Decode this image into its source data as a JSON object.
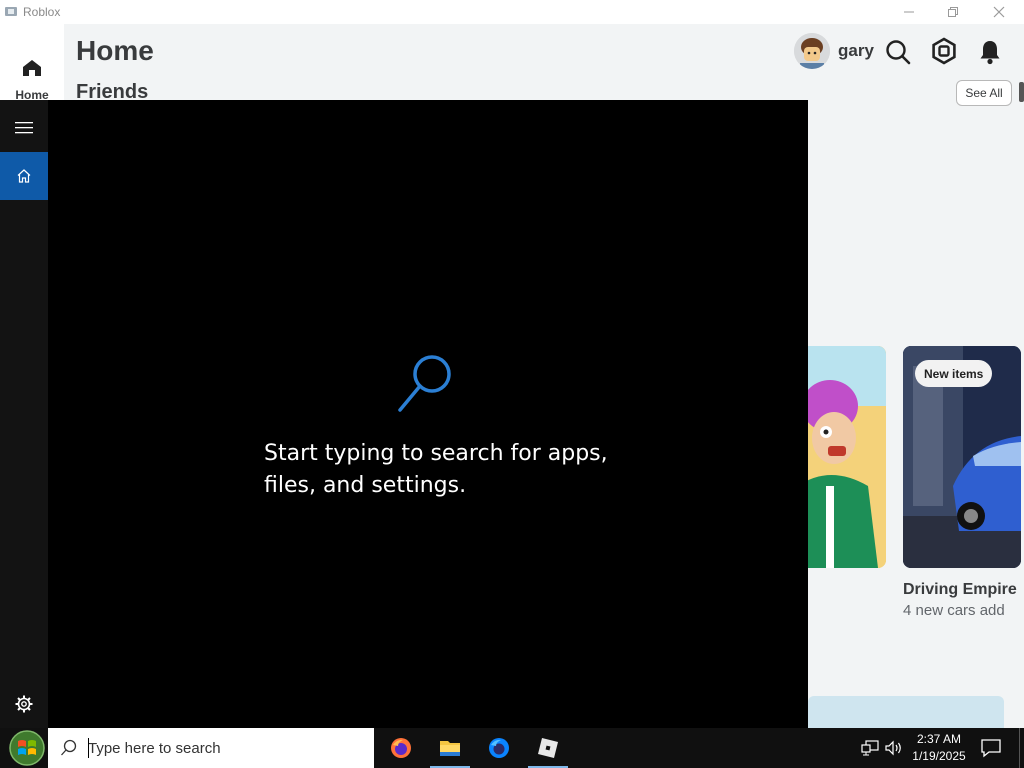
{
  "window": {
    "title": "Roblox",
    "controls": [
      "minimize",
      "restore",
      "close"
    ]
  },
  "roblox": {
    "nav": {
      "home_label": "Home"
    },
    "page_title": "Home",
    "friends_title": "Friends",
    "see_all": "See All",
    "user": {
      "name": "gary"
    },
    "header_icons": [
      "search-icon",
      "robux-icon",
      "notifications-icon"
    ],
    "game_card": {
      "badge": "New items",
      "title": "Driving Empire",
      "subtitle": "4 new cars add"
    }
  },
  "search_panel": {
    "hint": "Start typing to search for apps, files, and settings.",
    "accent": "#0f5aa8"
  },
  "taskbar": {
    "search_placeholder": "Type here to search",
    "apps": [
      "Firefox",
      "File Explorer",
      "Firefox",
      "Roblox"
    ],
    "time": "2:37 AM",
    "date": "1/19/2025"
  }
}
